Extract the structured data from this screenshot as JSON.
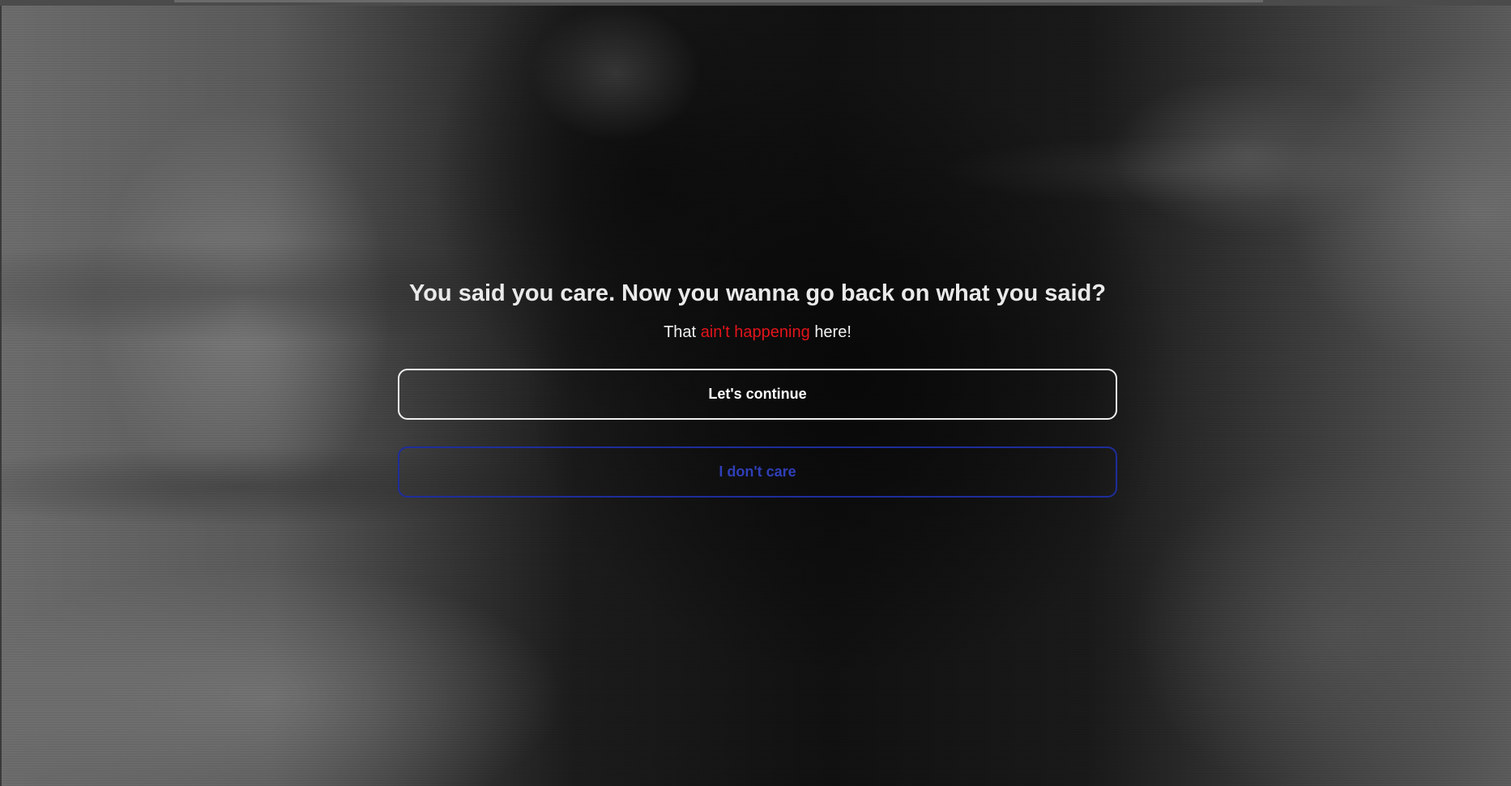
{
  "dialog": {
    "title": "You said you care. Now you wanna go back on what you said?",
    "subtitle_prefix": "That",
    "subtitle_highlight": "ain't happening",
    "subtitle_suffix": "here!",
    "highlight_color": "#e3141b"
  },
  "buttons": {
    "continue_label": "Let's continue",
    "dont_care_label": "I don't care",
    "dont_care_color": "#1e2d9a"
  }
}
